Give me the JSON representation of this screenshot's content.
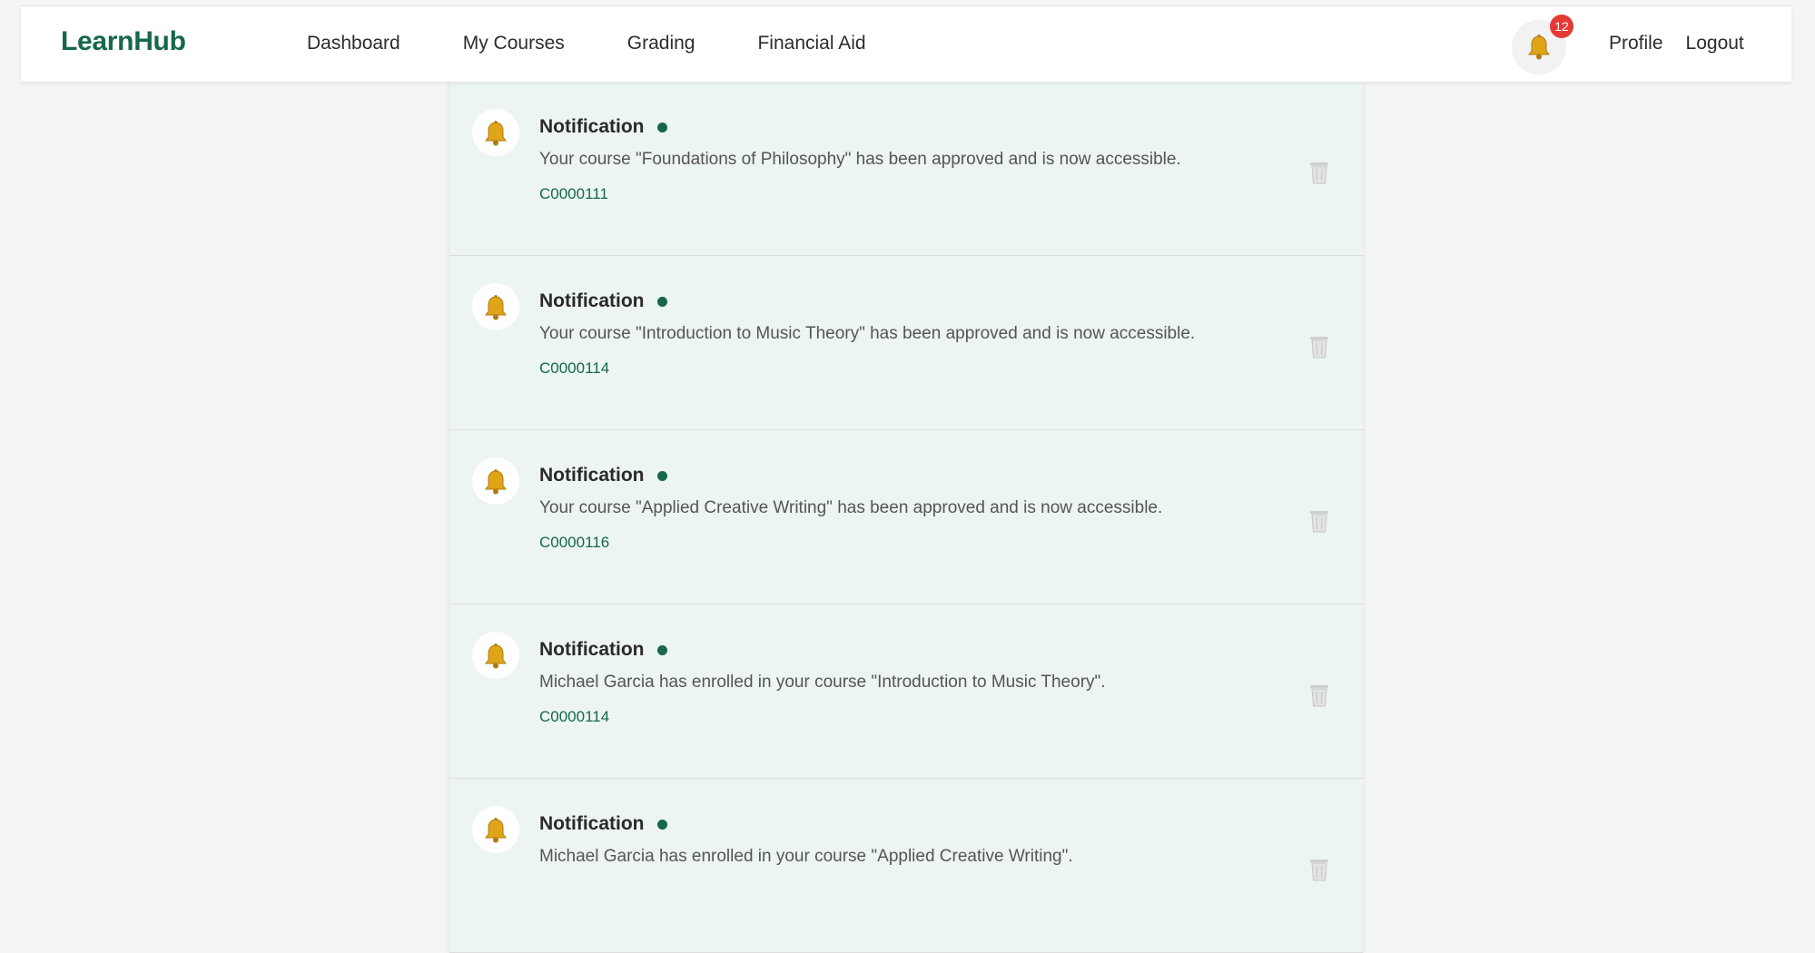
{
  "app": {
    "brand": "LearnHub",
    "accent_color": "#16674c",
    "badge_color": "#e53935"
  },
  "nav": {
    "links": [
      "Dashboard",
      "My Courses",
      "Grading",
      "Financial Aid"
    ],
    "notification_count": "12",
    "profile_label": "Profile",
    "logout_label": "Logout"
  },
  "notifications": [
    {
      "title": "Notification",
      "message": "Your course \"Foundations of Philosophy\" has been approved and is now accessible.",
      "course_code": "C0000111",
      "unread": true,
      "icon": "bell-icon"
    },
    {
      "title": "Notification",
      "message": "Your course \"Introduction to Music Theory\" has been approved and is now accessible.",
      "course_code": "C0000114",
      "unread": true,
      "icon": "bell-icon"
    },
    {
      "title": "Notification",
      "message": "Your course \"Applied Creative Writing\" has been approved and is now accessible.",
      "course_code": "C0000116",
      "unread": true,
      "icon": "bell-icon"
    },
    {
      "title": "Notification",
      "message": "Michael Garcia has enrolled in your course \"Introduction to Music Theory\".",
      "course_code": "C0000114",
      "unread": true,
      "icon": "bell-icon"
    },
    {
      "title": "Notification",
      "message": "Michael Garcia has enrolled in your course \"Applied Creative Writing\".",
      "course_code": "",
      "unread": true,
      "icon": "bell-icon"
    }
  ]
}
